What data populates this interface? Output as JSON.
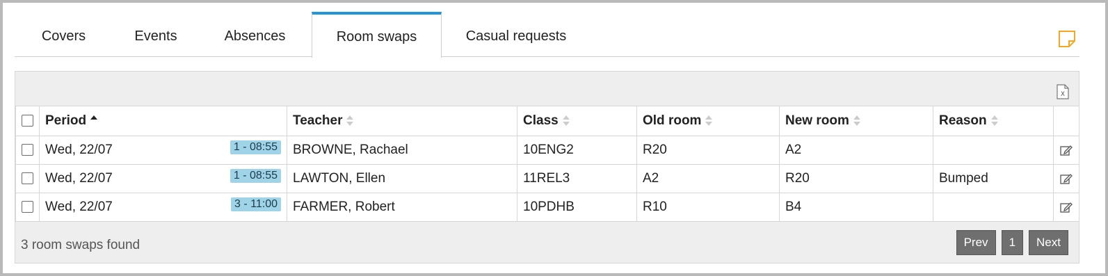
{
  "tabs": [
    {
      "label": "Covers"
    },
    {
      "label": "Events"
    },
    {
      "label": "Absences"
    },
    {
      "label": "Room swaps",
      "active": true
    },
    {
      "label": "Casual requests"
    }
  ],
  "table": {
    "headers": {
      "period": "Period",
      "teacher": "Teacher",
      "class": "Class",
      "old_room": "Old room",
      "new_room": "New room",
      "reason": "Reason"
    },
    "rows": [
      {
        "date": "Wed, 22/07",
        "period_badge": "1 - 08:55",
        "teacher": "BROWNE, Rachael",
        "class": "10ENG2",
        "old_room": "R20",
        "new_room": "A2",
        "reason": ""
      },
      {
        "date": "Wed, 22/07",
        "period_badge": "1 - 08:55",
        "teacher": "LAWTON, Ellen",
        "class": "11REL3",
        "old_room": "A2",
        "new_room": "R20",
        "reason": "Bumped"
      },
      {
        "date": "Wed, 22/07",
        "period_badge": "3 - 11:00",
        "teacher": "FARMER, Robert",
        "class": "10PDHB",
        "old_room": "R10",
        "new_room": "B4",
        "reason": ""
      }
    ]
  },
  "footer": {
    "count_text": "3 room swaps found",
    "prev_label": "Prev",
    "page": "1",
    "next_label": "Next"
  },
  "colors": {
    "active_tab_accent": "#2196d8",
    "period_badge_bg": "#9fd3e8",
    "note_icon": "#f5a623",
    "pager_button": "#6f6f6f"
  },
  "icons": {
    "note": "sticky-note-icon",
    "export": "excel-export-icon",
    "edit": "edit-icon"
  }
}
